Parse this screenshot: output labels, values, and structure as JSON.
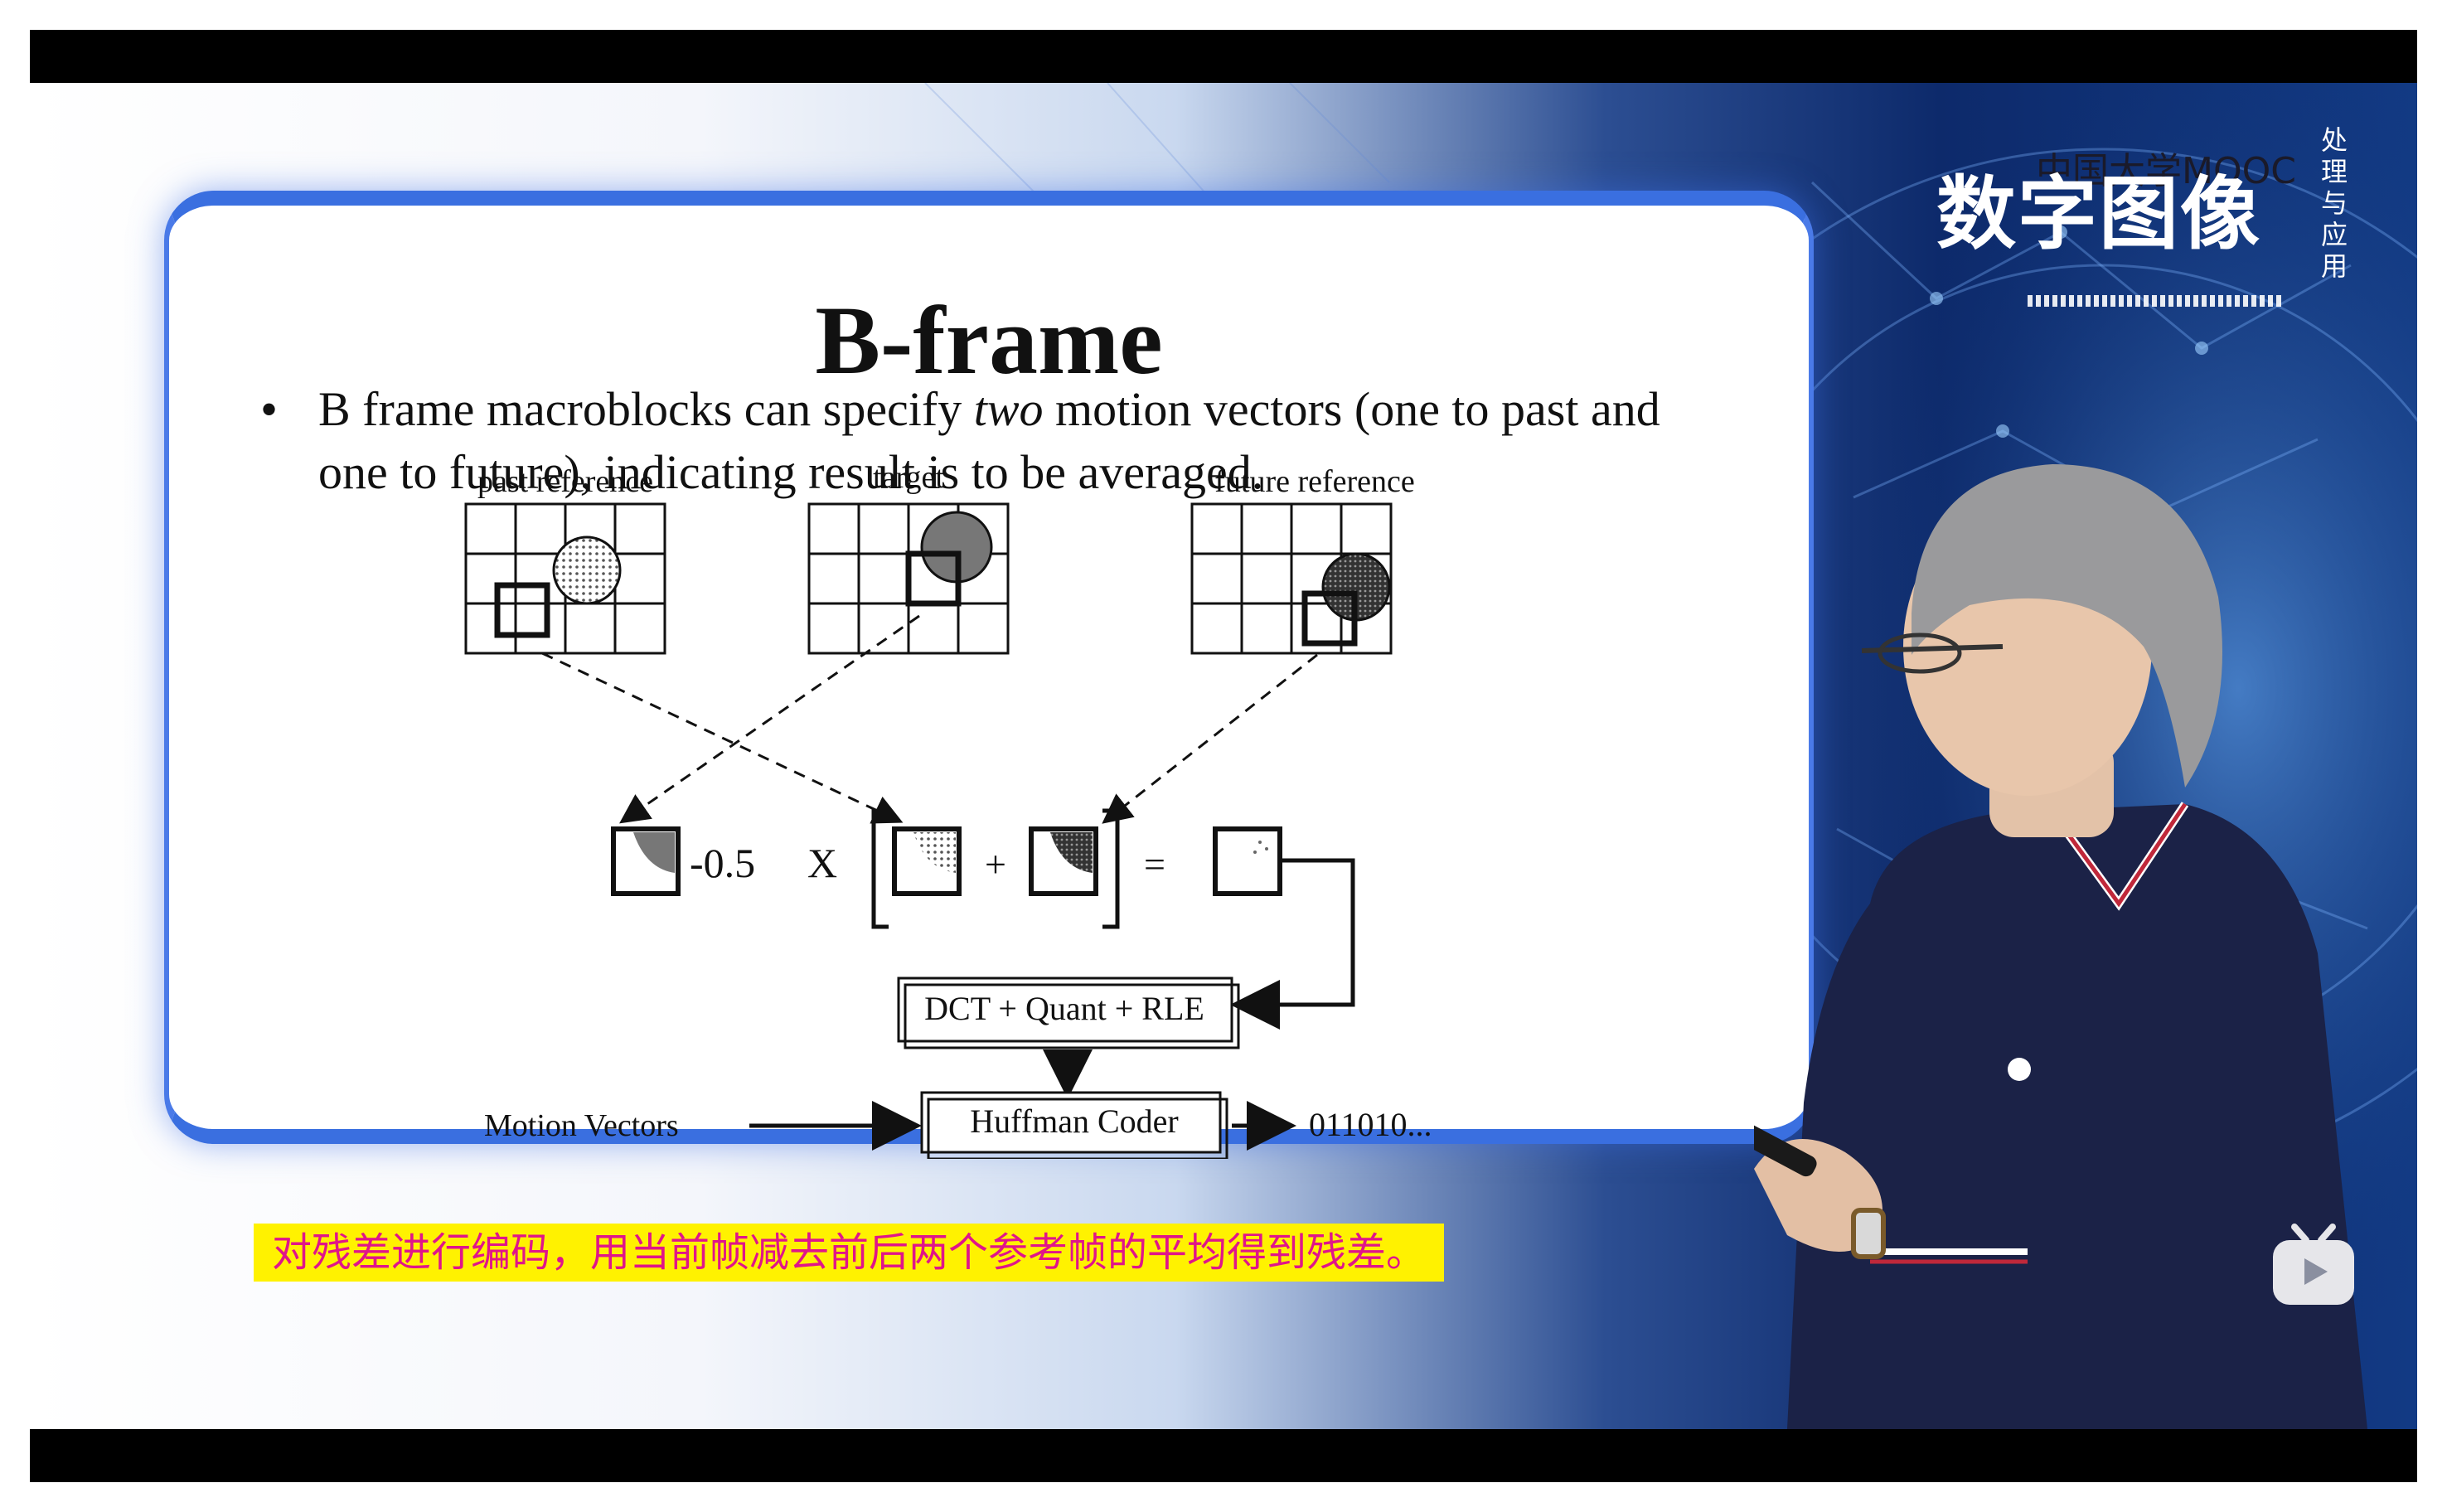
{
  "course_logo": {
    "main_text": "数字图像",
    "partner_text": "中国大学MOOC",
    "side_text": "处理与应用"
  },
  "slide": {
    "title": "B-frame",
    "bullet_part1": "B frame macroblocks can specify ",
    "bullet_emphasis": "two",
    "bullet_part2": " motion vectors (one to past and one to future), indicating result is to be averaged.",
    "diagram": {
      "label_past": "past reference",
      "label_target": "target",
      "label_future": "future reference",
      "coefficient": "-0.5",
      "multiply": "X",
      "plus": "+",
      "equals": "=",
      "dct_box": "DCT + Quant + RLE",
      "motion_vectors": "Motion Vectors",
      "huffman_box": "Huffman Coder",
      "output_bits": "011010..."
    }
  },
  "subtitle": "对残差进行编码，用当前帧减去前后两个参考帧的平均得到残差。",
  "colors": {
    "slide_border": "#3a6fe0",
    "subtitle_bg": "#fff200",
    "subtitle_text": "#e0158a",
    "shirt": "#1b2247"
  },
  "icons": {
    "player_badge": "bilibili-tv-icon"
  }
}
